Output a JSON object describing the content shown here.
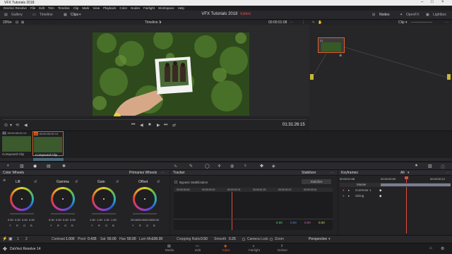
{
  "window": {
    "title": "VFX Tutorials 2018"
  },
  "menu": [
    "DaVinci Resolve",
    "File",
    "Edit",
    "Trim",
    "Timeline",
    "Clip",
    "Mark",
    "View",
    "Playback",
    "Color",
    "Nodes",
    "Fairlight",
    "Workspace",
    "Help"
  ],
  "toolbar": {
    "gallery": "Gallery",
    "timeline": "Timeline",
    "clips": "Clips",
    "project_title": "VFX Tutorials 2018",
    "edited": "Edited",
    "nodes": "Nodes",
    "openfx": "OpenFX",
    "lightbox": "Lightbox"
  },
  "viewer": {
    "zoom": "29%",
    "timeline_name": "Timeline 1",
    "timecode_in": "00:00:01:08",
    "clip_mode": "Clip",
    "playhead_timecode": "01:31:26:15"
  },
  "clips": [
    {
      "number": "01",
      "timecode": "00:00:00:00",
      "track": "V1",
      "name": "Compound Clip"
    },
    {
      "number": "02",
      "timecode": "00:00:00:00",
      "track": "V1",
      "name": "Compound Clip"
    }
  ],
  "node": {
    "label": "01"
  },
  "color_wheels": {
    "title": "Color Wheels",
    "mode": "Primaries Wheels",
    "wheels": [
      {
        "name": "Lift",
        "values": [
          "0.00",
          "0.00",
          "0.00",
          "0.00"
        ]
      },
      {
        "name": "Gamma",
        "values": [
          "0.00",
          "0.00",
          "0.00",
          "0.00"
        ]
      },
      {
        "name": "Gain",
        "values": [
          "1.00",
          "1.00",
          "1.00",
          "1.00"
        ]
      },
      {
        "name": "Offset",
        "values": [
          "25.00",
          "25.00",
          "25.00",
          "25.00"
        ]
      }
    ],
    "channels": [
      "Y",
      "R",
      "G",
      "B"
    ]
  },
  "tracker": {
    "title": "Tracker",
    "mode": "Stabilizer",
    "bypass": "Bypass Stabilization",
    "stabilize_btn": "Stabilize",
    "ruler": [
      "00:00:00:00",
      "00:00:00:10",
      "00:00:01:01",
      "00:00:01:20",
      "00:00:02:10",
      "00:00:03:01"
    ],
    "readouts": [
      "0.00",
      "0.00",
      "0.00",
      "0.00"
    ],
    "cropping_ratio_label": "Cropping Ratio",
    "cropping_ratio": "0.50",
    "smooth_label": "Smooth",
    "smooth": "0.25",
    "camera_lock": "Camera Lock",
    "zoom": "Zoom",
    "perspective": "Perspective"
  },
  "keyframes": {
    "title": "Keyframes",
    "filter": "All",
    "timecode_a": "00:00:01:08",
    "timecode_b": "00:00:00:09",
    "timecode_c": "00:00:00:12",
    "tracks": [
      "Master",
      "Corrector 1",
      "Sizing"
    ]
  },
  "bottom_controls": {
    "contrast_label": "Contrast",
    "contrast": "1.000",
    "pivot_label": "Pivot",
    "pivot": "0.435",
    "sat_label": "Sat",
    "sat": "50.00",
    "hue_label": "Hue",
    "hue": "50.00",
    "lum_mix_label": "Lum Mix",
    "lum_mix": "100.00",
    "page_num": "1",
    "page_num2": "2"
  },
  "pages": {
    "app": "DaVinci Resolve 14",
    "items": [
      "Media",
      "Edit",
      "Color",
      "Fairlight",
      "Deliver"
    ],
    "active": "Color"
  },
  "colors": {
    "accent": "#e0602a",
    "active_page": "#e0602a"
  }
}
